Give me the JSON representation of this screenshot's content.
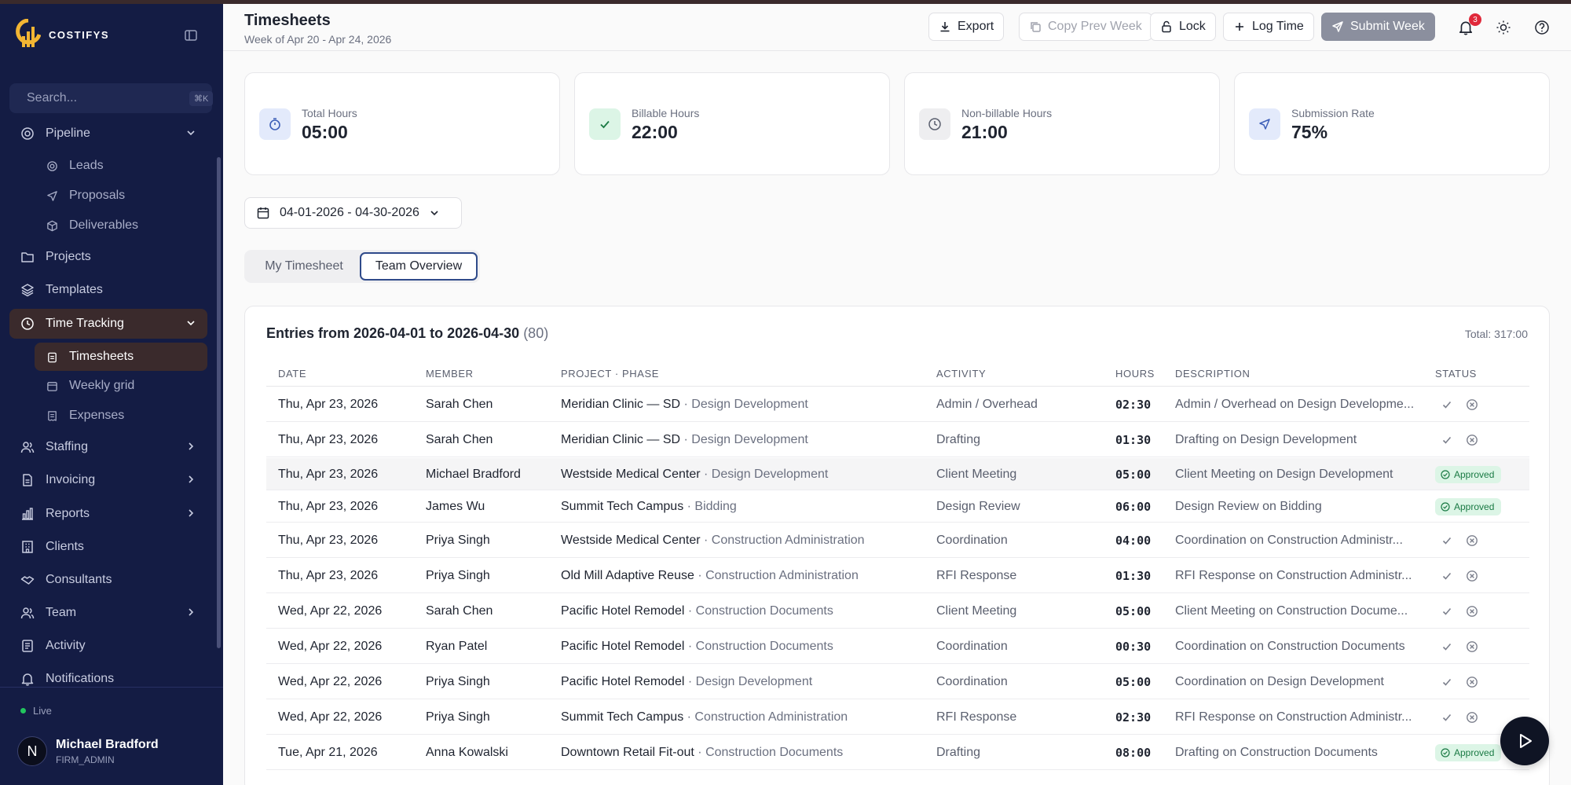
{
  "app": {
    "brand": "COSTIFYS"
  },
  "sidebar": {
    "search_placeholder": "Search...",
    "search_shortcut": "⌘K",
    "nav": {
      "pipeline": "Pipeline",
      "leads": "Leads",
      "proposals": "Proposals",
      "deliverables": "Deliverables",
      "projects": "Projects",
      "templates": "Templates",
      "time_tracking": "Time Tracking",
      "timesheets": "Timesheets",
      "weekly_grid": "Weekly grid",
      "expenses": "Expenses",
      "staffing": "Staffing",
      "invoicing": "Invoicing",
      "reports": "Reports",
      "clients": "Clients",
      "consultants": "Consultants",
      "team": "Team",
      "activity": "Activity",
      "notifications": "Notifications"
    },
    "status": "Live",
    "user": {
      "initial": "N",
      "name": "Michael Bradford",
      "role": "FIRM_ADMIN"
    }
  },
  "header": {
    "title": "Timesheets",
    "subtitle": "Week of Apr 20 - Apr 24, 2026",
    "buttons": {
      "export": "Export",
      "copy_prev_week": "Copy Prev Week",
      "lock": "Lock",
      "log_time": "Log Time",
      "submit_week": "Submit Week"
    },
    "notification_count": "3"
  },
  "stats": {
    "total_hours": {
      "label": "Total Hours",
      "value": "05:00"
    },
    "billable_hours": {
      "label": "Billable Hours",
      "value": "22:00"
    },
    "nonbillable_hours": {
      "label": "Non-billable Hours",
      "value": "21:00"
    },
    "submission_rate": {
      "label": "Submission Rate",
      "value": "75%"
    }
  },
  "date_range": "04-01-2026 - 04-30-2026",
  "tabs": {
    "my_timesheet": "My Timesheet",
    "team_overview": "Team Overview"
  },
  "table": {
    "title": "Entries from 2026-04-01 to 2026-04-30",
    "count": "(80)",
    "total": "Total: 317:00",
    "columns": {
      "date": "DATE",
      "member": "MEMBER",
      "project": "PROJECT · PHASE",
      "activity": "ACTIVITY",
      "hours": "HOURS",
      "description": "DESCRIPTION",
      "status": "STATUS"
    },
    "approved_label": "Approved",
    "rows": [
      {
        "date": "Thu, Apr 23, 2026",
        "member": "Sarah Chen",
        "project": "Meridian Clinic — SD",
        "phase": "· Design Development",
        "activity": "Admin / Overhead",
        "hours": "02:30",
        "description": "Admin / Overhead on Design Developme...",
        "status": "pending"
      },
      {
        "date": "Thu, Apr 23, 2026",
        "member": "Sarah Chen",
        "project": "Meridian Clinic — SD",
        "phase": "· Design Development",
        "activity": "Drafting",
        "hours": "01:30",
        "description": "Drafting on Design Development",
        "status": "pending"
      },
      {
        "date": "Thu, Apr 23, 2026",
        "member": "Michael Bradford",
        "project": "Westside Medical Center",
        "phase": "· Design Development",
        "activity": "Client Meeting",
        "hours": "05:00",
        "description": "Client Meeting on Design Development",
        "status": "approved"
      },
      {
        "date": "Thu, Apr 23, 2026",
        "member": "James Wu",
        "project": "Summit Tech Campus",
        "phase": "· Bidding",
        "activity": "Design Review",
        "hours": "06:00",
        "description": "Design Review on Bidding",
        "status": "approved"
      },
      {
        "date": "Thu, Apr 23, 2026",
        "member": "Priya Singh",
        "project": "Westside Medical Center",
        "phase": "· Construction Administration",
        "activity": "Coordination",
        "hours": "04:00",
        "description": "Coordination on Construction Administr...",
        "status": "pending"
      },
      {
        "date": "Thu, Apr 23, 2026",
        "member": "Priya Singh",
        "project": "Old Mill Adaptive Reuse",
        "phase": "· Construction Administration",
        "activity": "RFI Response",
        "hours": "01:30",
        "description": "RFI Response on Construction Administr...",
        "status": "pending"
      },
      {
        "date": "Wed, Apr 22, 2026",
        "member": "Sarah Chen",
        "project": "Pacific Hotel Remodel",
        "phase": "· Construction Documents",
        "activity": "Client Meeting",
        "hours": "05:00",
        "description": "Client Meeting on Construction Docume...",
        "status": "pending"
      },
      {
        "date": "Wed, Apr 22, 2026",
        "member": "Ryan Patel",
        "project": "Pacific Hotel Remodel",
        "phase": "· Construction Documents",
        "activity": "Coordination",
        "hours": "00:30",
        "description": "Coordination on Construction Documents",
        "status": "pending"
      },
      {
        "date": "Wed, Apr 22, 2026",
        "member": "Priya Singh",
        "project": "Pacific Hotel Remodel",
        "phase": "· Design Development",
        "activity": "Coordination",
        "hours": "05:00",
        "description": "Coordination on Design Development",
        "status": "pending"
      },
      {
        "date": "Wed, Apr 22, 2026",
        "member": "Priya Singh",
        "project": "Summit Tech Campus",
        "phase": "· Construction Administration",
        "activity": "RFI Response",
        "hours": "02:30",
        "description": "RFI Response on Construction Administr...",
        "status": "pending"
      },
      {
        "date": "Tue, Apr 21, 2026",
        "member": "Anna Kowalski",
        "project": "Downtown Retail Fit-out",
        "phase": "· Construction Documents",
        "activity": "Drafting",
        "hours": "08:00",
        "description": "Drafting on Construction Documents",
        "status": "approved"
      }
    ]
  },
  "colors": {
    "sidebar_bg": "#141c44",
    "active_nav": "#3a2a2c",
    "approved_bg": "#dcf5e6",
    "approved_text": "#1a7a44",
    "badge": "#e0283a"
  }
}
